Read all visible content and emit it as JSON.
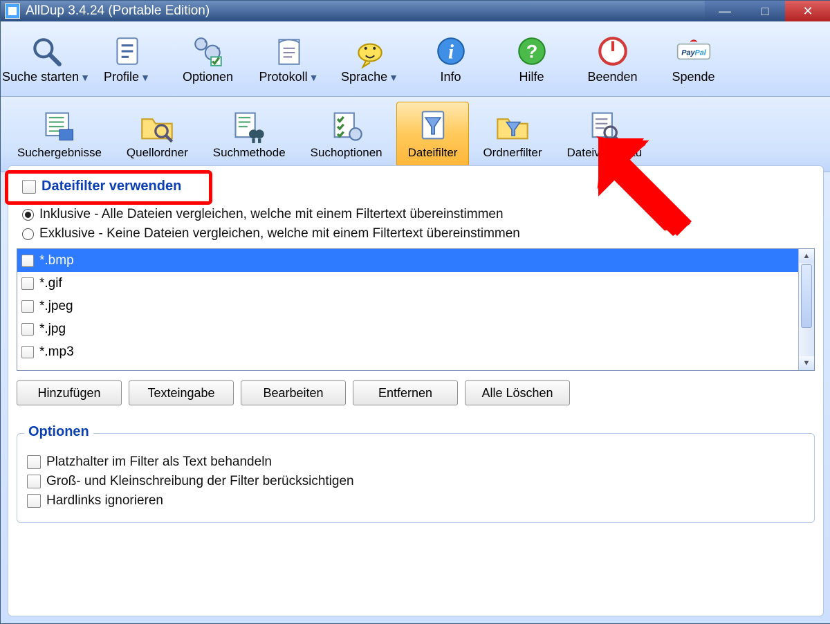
{
  "title": "AllDup 3.4.24 (Portable Edition)",
  "window_controls": {
    "minimize": "—",
    "maximize": "□",
    "close": "✕"
  },
  "toolbar_main": [
    {
      "label": "Suche starten",
      "icon": "search-icon",
      "dropdown": true
    },
    {
      "label": "Profile",
      "icon": "profile-icon",
      "dropdown": true
    },
    {
      "label": "Optionen",
      "icon": "options-icon",
      "dropdown": false
    },
    {
      "label": "Protokoll",
      "icon": "protocol-icon",
      "dropdown": true
    },
    {
      "label": "Sprache",
      "icon": "language-icon",
      "dropdown": true
    },
    {
      "label": "Info",
      "icon": "info-icon",
      "dropdown": false
    },
    {
      "label": "Hilfe",
      "icon": "help-icon",
      "dropdown": false
    },
    {
      "label": "Beenden",
      "icon": "exit-icon",
      "dropdown": false
    },
    {
      "label": "Spende",
      "icon": "paypal-icon",
      "dropdown": false
    }
  ],
  "toolbar_tabs": [
    {
      "label": "Suchergebnisse",
      "icon": "results-icon",
      "active": false
    },
    {
      "label": "Quellordner",
      "icon": "source-folder-icon",
      "active": false
    },
    {
      "label": "Suchmethode",
      "icon": "search-method-icon",
      "active": false
    },
    {
      "label": "Suchoptionen",
      "icon": "search-options-icon",
      "active": false
    },
    {
      "label": "Dateifilter",
      "icon": "file-filter-icon",
      "active": true
    },
    {
      "label": "Ordnerfilter",
      "icon": "folder-filter-icon",
      "active": false
    },
    {
      "label": "Dateivorschau",
      "icon": "file-preview-icon",
      "active": false
    }
  ],
  "filefilter": {
    "use_filter_label": "Dateifilter verwenden",
    "use_filter_checked": false,
    "mode_inclusive": "Inklusive - Alle Dateien vergleichen, welche mit einem Filtertext übereinstimmen",
    "mode_exclusive": "Exklusive - Keine Dateien vergleichen, welche mit einem Filtertext übereinstimmen",
    "mode_selected": "inclusive",
    "patterns": [
      {
        "text": "*.bmp",
        "checked": false,
        "selected": true
      },
      {
        "text": "*.gif",
        "checked": false,
        "selected": false
      },
      {
        "text": "*.jpeg",
        "checked": false,
        "selected": false
      },
      {
        "text": "*.jpg",
        "checked": false,
        "selected": false
      },
      {
        "text": "*.mp3",
        "checked": false,
        "selected": false
      }
    ],
    "buttons": {
      "add": "Hinzufügen",
      "text_input": "Texteingabe",
      "edit": "Bearbeiten",
      "remove": "Entfernen",
      "clear_all": "Alle Löschen"
    }
  },
  "option_group": {
    "title": "Optionen",
    "opt_wildcard_as_text": "Platzhalter im Filter als Text behandeln",
    "opt_case_sensitive": "Groß- und Kleinschreibung der Filter berücksichtigen",
    "opt_ignore_hardlinks": "Hardlinks ignorieren"
  }
}
